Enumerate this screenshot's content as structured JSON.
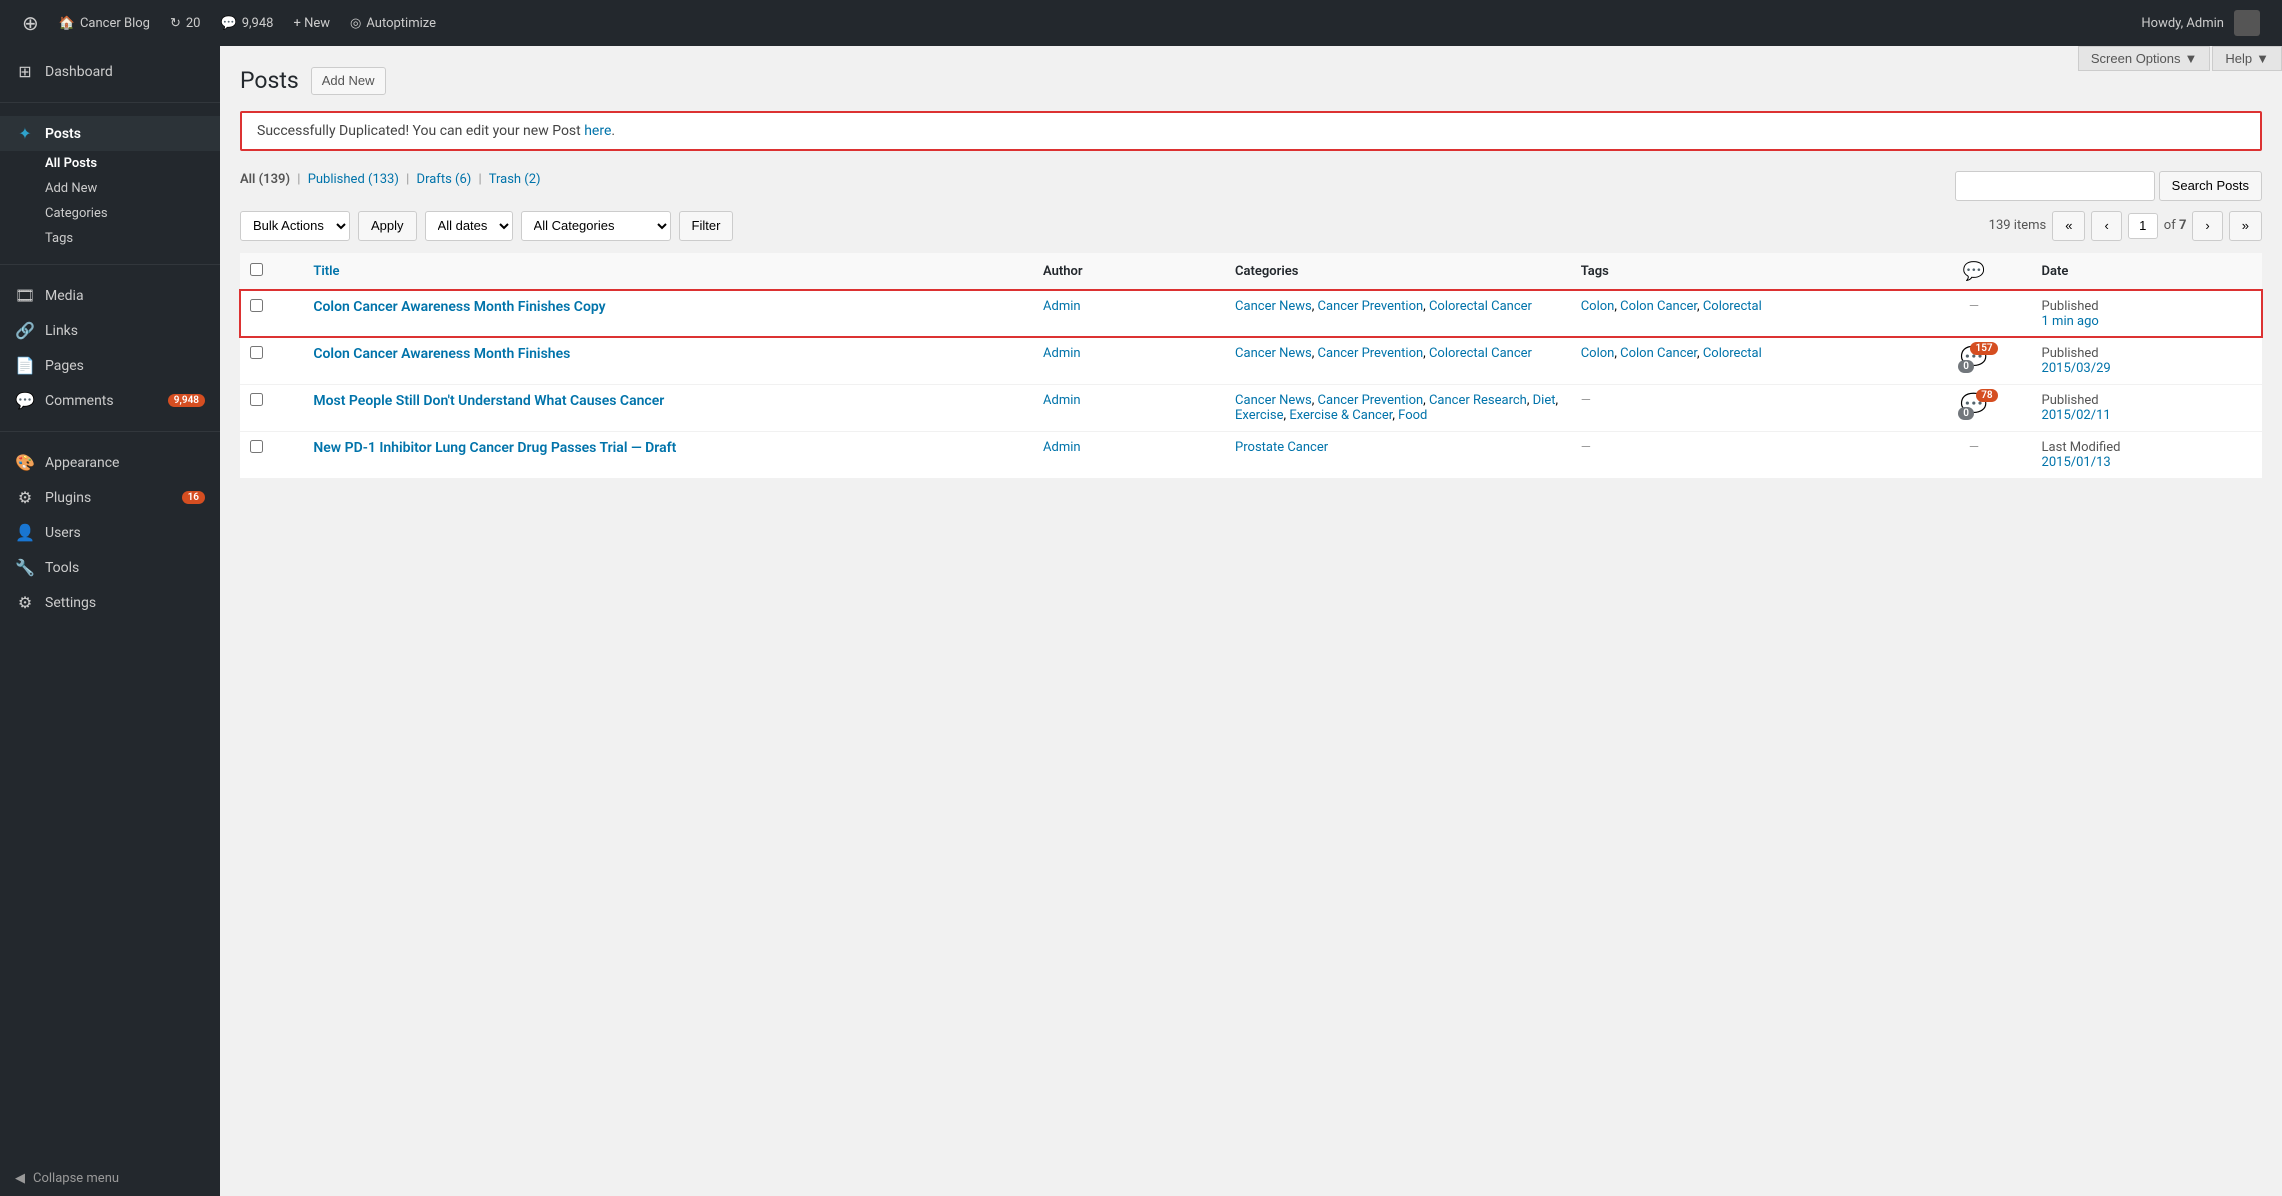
{
  "adminbar": {
    "site_name": "Cancer Blog",
    "updates_count": "20",
    "comments_count": "9,948",
    "new_label": "+ New",
    "autoptimize_label": "Autoptimize",
    "howdy": "Howdy, Admin"
  },
  "screen_options": {
    "label": "Screen Options",
    "help_label": "Help"
  },
  "page": {
    "title": "Posts",
    "add_new": "Add New"
  },
  "notice": {
    "text": "Successfully Duplicated! You can edit your new Post ",
    "link_text": "here",
    "suffix": "."
  },
  "filter_links": {
    "all": "All",
    "all_count": "139",
    "published": "Published",
    "published_count": "133",
    "drafts": "Drafts",
    "drafts_count": "6",
    "trash": "Trash",
    "trash_count": "2"
  },
  "actions": {
    "bulk_actions": "Bulk Actions",
    "apply": "Apply",
    "all_dates": "All dates",
    "all_categories": "All Categories",
    "filter": "Filter",
    "item_count": "139 items",
    "page_current": "1",
    "page_total": "7",
    "search_placeholder": "",
    "search_button": "Search Posts"
  },
  "table": {
    "col_title": "Title",
    "col_author": "Author",
    "col_categories": "Categories",
    "col_tags": "Tags",
    "col_date": "Date"
  },
  "posts": [
    {
      "id": 1,
      "title": "Colon Cancer Awareness Month Finishes Copy",
      "author": "Admin",
      "categories": [
        "Cancer News",
        "Cancer Prevention",
        "Colorectal Cancer"
      ],
      "tags": [
        "Colon",
        "Colon Cancer",
        "Colorectal"
      ],
      "comments_approved": "",
      "comments_pending": "",
      "comments_dash": "—",
      "date_label": "Published",
      "date_value": "1 min ago",
      "highlighted": true,
      "draft": false
    },
    {
      "id": 2,
      "title": "Colon Cancer Awareness Month Finishes",
      "author": "Admin",
      "categories": [
        "Cancer News",
        "Cancer Prevention",
        "Colorectal Cancer"
      ],
      "tags": [
        "Colon",
        "Colon Cancer",
        "Colorectal"
      ],
      "comments_approved": "0",
      "comments_pending": "157",
      "comments_dash": "",
      "date_label": "Published",
      "date_value": "2015/03/29",
      "highlighted": false,
      "draft": false
    },
    {
      "id": 3,
      "title": "Most People Still Don't Understand What Causes Cancer",
      "author": "Admin",
      "categories": [
        "Cancer News",
        "Cancer Prevention",
        "Cancer Research",
        "Diet",
        "Exercise",
        "Exercise & Cancer",
        "Food"
      ],
      "tags": [],
      "comments_approved": "0",
      "comments_pending": "78",
      "comments_dash": "—",
      "date_label": "Published",
      "date_value": "2015/02/11",
      "highlighted": false,
      "draft": false
    },
    {
      "id": 4,
      "title": "New PD-1 Inhibitor Lung Cancer Drug Passes Trial",
      "author": "Admin",
      "categories": [
        "Prostate Cancer"
      ],
      "tags": [],
      "comments_approved": "",
      "comments_pending": "",
      "comments_dash": "—",
      "date_label": "Last Modified",
      "date_value": "2015/01/13",
      "highlighted": false,
      "draft": true
    }
  ],
  "sidebar": {
    "dashboard": "Dashboard",
    "posts": "Posts",
    "posts_sub": {
      "all_posts": "All Posts",
      "add_new": "Add New",
      "categories": "Categories",
      "tags": "Tags"
    },
    "media": "Media",
    "links": "Links",
    "pages": "Pages",
    "comments": "Comments",
    "comments_badge": "9,948",
    "appearance": "Appearance",
    "plugins": "Plugins",
    "plugins_badge": "16",
    "users": "Users",
    "tools": "Tools",
    "settings": "Settings",
    "collapse": "Collapse menu"
  }
}
